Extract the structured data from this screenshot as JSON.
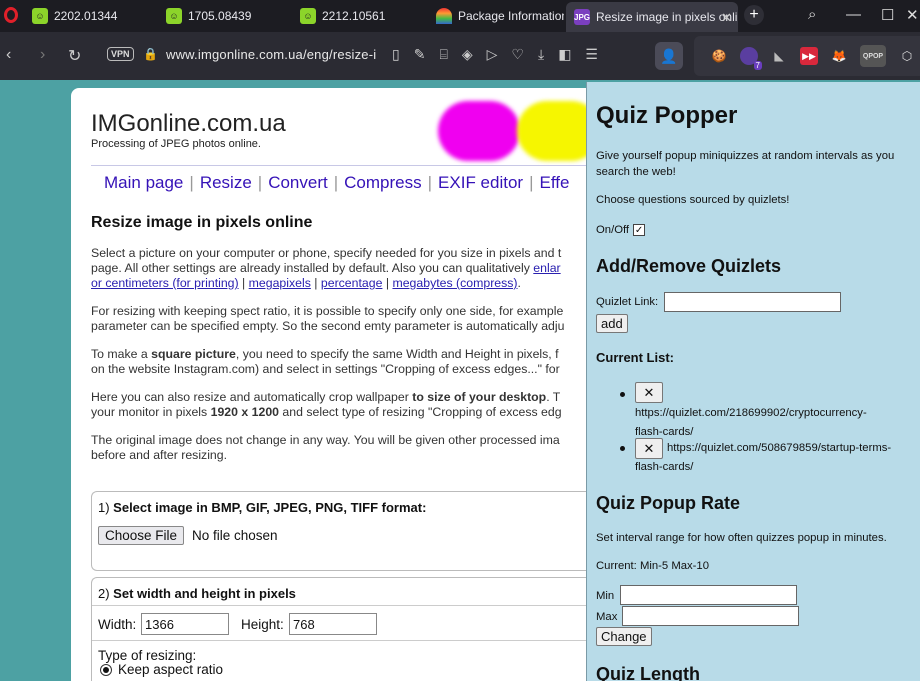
{
  "tabs": [
    {
      "title": "2202.01344",
      "icon": "green-face-icon"
    },
    {
      "title": "1705.08439",
      "icon": "green-face-icon"
    },
    {
      "title": "2212.10561",
      "icon": "green-face-icon"
    },
    {
      "title": "Package Information",
      "icon": "rainbow-icon"
    },
    {
      "title": "Resize image in pixels onli",
      "icon": "jpg-icon",
      "favicon_text": "JPG",
      "active": true
    }
  ],
  "address": {
    "vpn": "VPN",
    "url": "www.imgonline.com.ua/eng/resize-i"
  },
  "extensions": {
    "badge": "7",
    "qpop_label": "QPOP"
  },
  "site": {
    "logo": "IMGonline.com.ua",
    "tagline": "Processing of JPEG photos online.",
    "menu": [
      "Main page",
      "Resize",
      "Convert",
      "Compress",
      "EXIF editor",
      "Effe"
    ],
    "heading": "Resize image in pixels online",
    "p1_l1": "Select a picture on your computer or phone, specify needed for you size in pixels and t",
    "p1_l2a": "page. All other settings are already installed by default. Also you can qualitatively ",
    "p1_l2_link": "enlar",
    "p1_l3_links": [
      "or centimeters (for printing)",
      "megapixels",
      "percentage",
      "megabytes (compress)"
    ],
    "p1_l3_end": ".",
    "p2_l1": "For resizing with keeping spect ratio, it is possible to specify only one side, for example",
    "p2_l2": "parameter can be specified empty. So the second emty parameter is automatically adju",
    "p3_l1a": "To make a ",
    "p3_l1b": "square picture",
    "p3_l1c": ", you need to specify the same Width and Height in pixels, f",
    "p3_l2": "on the website Instagram.com) and select in settings \"Cropping of excess edges...\" for",
    "p4_l1a": "Here you can also resize and automatically crop wallpaper ",
    "p4_l1b": "to size of your desktop",
    "p4_l1c": ". T",
    "p4_l2a": "your monitor in pixels ",
    "p4_l2b": "1920 x 1200",
    "p4_l2c": " and select type of resizing \"Cropping of excess edg",
    "p5_l1": "The original image does not change in any way. You will be given other processed ima",
    "p5_l2": "before and after resizing.",
    "step1_num": "1) ",
    "step1_title": "Select image in BMP, GIF, JPEG, PNG, TIFF format:",
    "choose_file": "Choose File",
    "no_file": "No file chosen",
    "step2_num": "2) ",
    "step2_title": "Set width and height in pixels",
    "width_label": "Width:",
    "width_value": "1366",
    "height_label": "Height:",
    "height_value": "768",
    "resize_type_label": "Type of resizing:",
    "keep_aspect": "Keep aspect ratio"
  },
  "popup": {
    "title": "Quiz Popper",
    "intro": "Give yourself popup miniquizzes at random intervals as you search the web!",
    "source_note": "Choose questions sourced by quizlets!",
    "onoff_label": "On/Off",
    "onoff_checked": "✓",
    "addremove_heading": "Add/Remove Quizlets",
    "quizlet_link_label": "Quizlet Link:",
    "quizlet_link_value": "",
    "add_button": "add",
    "current_list_heading": "Current List:",
    "list": [
      {
        "remove": "✕",
        "url_l1": "https://quizlet.com/218699902/cryptocurrency-",
        "url_l2": "flash-cards/"
      },
      {
        "remove": "✕",
        "url_l1": "https://quizlet.com/508679859/startup-terms-",
        "url_l2": "flash-cards/"
      }
    ],
    "rate_heading": "Quiz Popup Rate",
    "rate_desc": "Set interval range for how often quizzes popup in minutes.",
    "rate_current": "Current: Min-5 Max-10",
    "min_label": "Min",
    "max_label": "Max",
    "change_button": "Change",
    "length_heading": "Quiz Length"
  }
}
